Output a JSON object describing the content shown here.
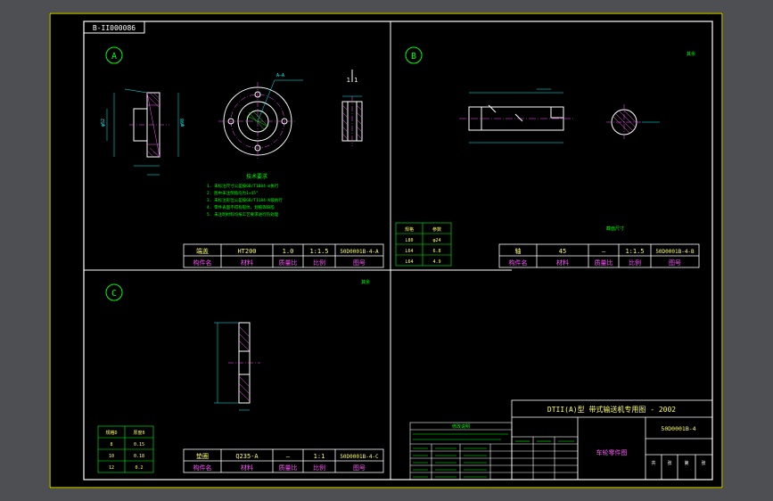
{
  "drawing_code": "B-II000086",
  "views": {
    "a_label": "A",
    "b_label": "B",
    "c_label": "C",
    "section_label": "1:1",
    "top_dim": "A—A"
  },
  "tech_notes": {
    "title": "技术要求",
    "lines": [
      "1. 未标注尺寸公差按GB/T1804-m执行",
      "2. 图中未注倒角均为1×45°",
      "3. 未标注形位公差按GB/T1184-K级执行",
      "4. 零件表面不得有裂纹、划痕等缺陷",
      "5. 未注明材料均按工艺要求进行热处理"
    ]
  },
  "title_block_a": {
    "part": "端盖",
    "material": "HT200",
    "qty": "1.0",
    "scale": "1:1.5",
    "code": "50D0001B-4-A",
    "h_part": "构件名",
    "h_material": "材料",
    "h_qty": "质量比",
    "h_scale": "比例",
    "h_code": "图号"
  },
  "title_block_b": {
    "part": "轴",
    "material": "45",
    "qty": "—",
    "scale": "1:1.5",
    "code": "50D0001B-4-B",
    "h_part": "构件名",
    "h_material": "材料",
    "h_qty": "质量比",
    "h_scale": "比例",
    "h_code": "图号"
  },
  "title_block_c": {
    "part": "垫圈",
    "material": "Q235-A",
    "qty": "—",
    "scale": "1:1",
    "code": "50D0001B-4-C",
    "h_part": "构件名",
    "h_material": "材料",
    "h_qty": "质量比",
    "h_scale": "比例",
    "h_code": "图号"
  },
  "table_b": {
    "headers": [
      "规格",
      "参数"
    ],
    "rows": [
      [
        "L80",
        "φ24"
      ],
      [
        "L64",
        "6.8"
      ],
      [
        "L64",
        "4.9"
      ]
    ]
  },
  "table_c": {
    "headers": [
      "规格D",
      "厚度δ"
    ],
    "rows": [
      [
        "8",
        "0.15"
      ],
      [
        "10",
        "0.18"
      ],
      [
        "12",
        "0.2"
      ]
    ]
  },
  "section_note": "截面尺寸",
  "roughness_note": "其余",
  "main_title": {
    "line1": "DTII(A)型   带式输送机专用图 - 2002",
    "code": "50D0001B-4",
    "name": "车轮零件图",
    "footer_labels": [
      "共",
      "张",
      "第",
      "张"
    ]
  },
  "revision_table_title": "修改说明",
  "colors": {
    "frame": "#ffff00",
    "outline": "#ffffff",
    "part": "#00ff00",
    "dim": "#00ffff",
    "text_pink": "#ff55ff",
    "text_yellow": "#ffff66",
    "bg": "#000000"
  }
}
